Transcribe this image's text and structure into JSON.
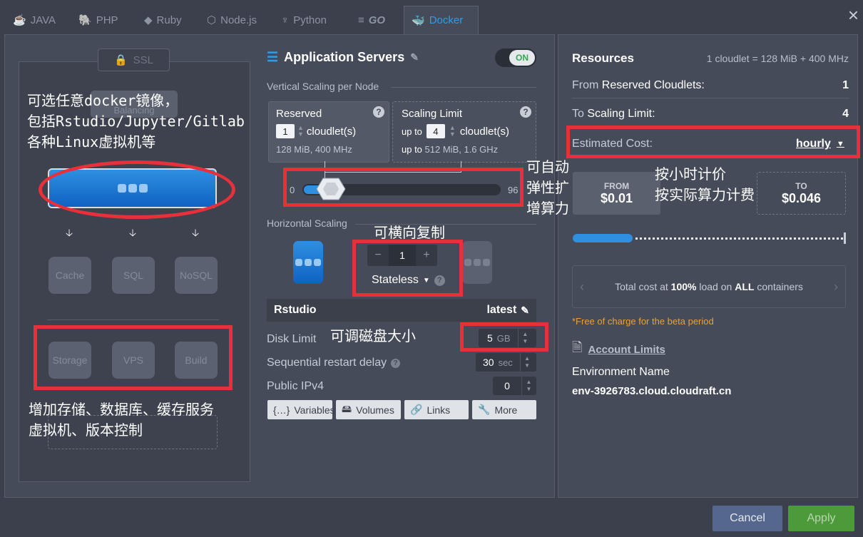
{
  "tabs": [
    {
      "label": "JAVA",
      "icon": "java-icon"
    },
    {
      "label": "PHP",
      "icon": "php-icon"
    },
    {
      "label": "Ruby",
      "icon": "ruby-icon"
    },
    {
      "label": "Node.js",
      "icon": "nodejs-icon"
    },
    {
      "label": "Python",
      "icon": "python-icon"
    },
    {
      "label": "GO",
      "icon": "go-icon"
    },
    {
      "label": "Docker",
      "icon": "docker-icon",
      "active": true
    }
  ],
  "topology": {
    "ssl_label": "SSL",
    "balancing_label": "Balancing",
    "services": [
      "Cache",
      "SQL",
      "NoSQL"
    ],
    "extras": [
      "Storage",
      "VPS",
      "Build"
    ]
  },
  "app_servers": {
    "title": "Application Servers",
    "toggle_label": "ON",
    "vertical_scaling_label": "Vertical Scaling per Node",
    "reserved": {
      "title": "Reserved",
      "value": "1",
      "unit": "cloudlet(s)",
      "spec": "128 MiB, 400 MHz"
    },
    "scaling_limit": {
      "title": "Scaling Limit",
      "prefix": "up to",
      "value": "4",
      "unit": "cloudlet(s)",
      "spec_prefix": "up to",
      "spec": "512 MiB, 1.6 GHz"
    },
    "slider_min": "0",
    "slider_max": "96",
    "horizontal_scaling_label": "Horizontal Scaling",
    "node_count": "1",
    "stepper_minus": "−",
    "stepper_plus": "+",
    "mode": "Stateless",
    "image_name": "Rstudio",
    "image_tag": "latest",
    "disk_limit_label": "Disk Limit",
    "disk_value": "5",
    "disk_unit": "GB",
    "restart_delay_label": "Sequential restart delay",
    "restart_value": "30",
    "restart_unit": "sec",
    "ipv4_label": "Public IPv4",
    "ipv4_value": "0",
    "buttons": [
      "Variables",
      "Volumes",
      "Links",
      "More"
    ]
  },
  "resources": {
    "title": "Resources",
    "cloudlet_def": "1 cloudlet = 128 MiB + 400 MHz",
    "from_prefix": "From",
    "from_label": "Reserved Cloudlets:",
    "from_value": "1",
    "to_prefix": "To",
    "to_label": "Scaling Limit:",
    "to_value": "4",
    "cost_label": "Estimated Cost:",
    "cost_period": "hourly",
    "from_box_label": "FROM",
    "from_price": "$0.01",
    "to_box_label": "TO",
    "to_price": "$0.046",
    "bar_fill_fraction": 0.22,
    "total_cost_pre": "Total cost at",
    "total_cost_pct": "100%",
    "total_cost_mid": "load on",
    "total_cost_all": "ALL",
    "total_cost_post": "containers",
    "beta_note": "*Free of charge for the beta period",
    "account_limits": "Account Limits",
    "env_name_label": "Environment Name",
    "env_name": "env-3926783.cloud.cloudraft.cn"
  },
  "footer": {
    "cancel": "Cancel",
    "apply": "Apply"
  },
  "annotations": {
    "docker_note_1": "可选任意docker镜像，",
    "docker_note_2": "包括Rstudio/Jupyter/Gitlab",
    "docker_note_3": "各种Linux虚拟机等",
    "auto_scale_1": "可自动",
    "auto_scale_2": "弹性扩",
    "auto_scale_3": "增算力",
    "horizontal_note": "可横向复制",
    "disk_note": "可调磁盘大小",
    "billing_note_1": "按小时计价",
    "billing_note_2": "按实际算力计费",
    "storage_note_1": "增加存储、数据库、缓存服务",
    "storage_note_2": "虚拟机、版本控制"
  },
  "colors": {
    "accent": "#2f8fe0",
    "annotation": "#e8303a",
    "apply": "#4c9a3a",
    "cancel": "#56678e"
  }
}
